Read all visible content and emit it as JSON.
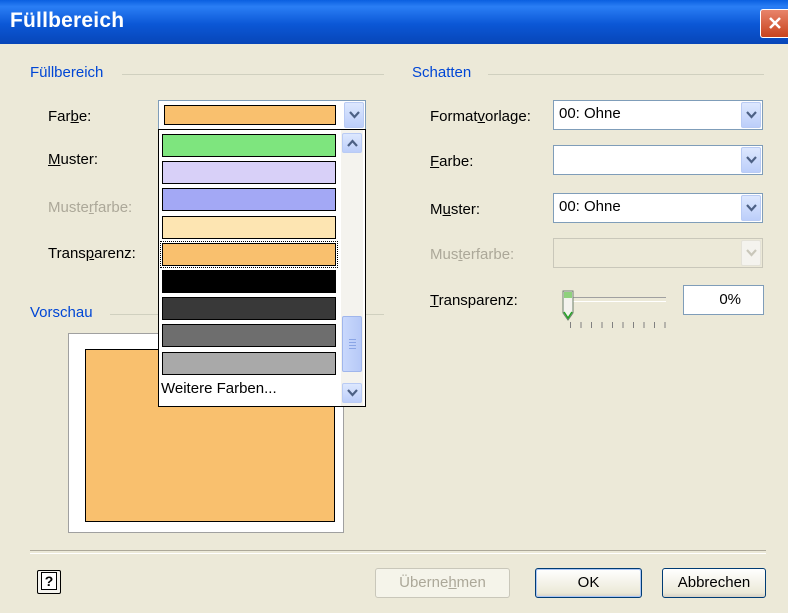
{
  "window": {
    "title": "Füllbereich",
    "close_icon": "close-icon"
  },
  "fill_group": {
    "title": "Füllbereich",
    "color_label": {
      "pre": "Far",
      "u": "b",
      "post": "e:"
    },
    "pattern_label": {
      "pre": "",
      "u": "M",
      "post": "uster:"
    },
    "pattern_color_label": {
      "pre": "Muste",
      "u": "r",
      "post": "farbe:"
    },
    "transparency_label": {
      "pre": "Trans",
      "u": "p",
      "post": "arenz:"
    },
    "selected_color": "#f9c06e"
  },
  "color_dropdown": {
    "items": [
      {
        "color": "#7ee57e"
      },
      {
        "color": "#d8d0f8"
      },
      {
        "color": "#a3a8f5"
      },
      {
        "color": "#fde5b2"
      },
      {
        "color": "#f9c06e",
        "selected": true
      },
      {
        "color": "#000000"
      },
      {
        "color": "#393939"
      },
      {
        "color": "#6e6e6e"
      },
      {
        "color": "#a9a9a9"
      }
    ],
    "more_colors": "Weitere Farben..."
  },
  "preview_group": {
    "title": "Vorschau",
    "shape_color": "#f9c06e"
  },
  "shadow_group": {
    "title": "Schatten",
    "style_label": {
      "pre": "Format",
      "u": "v",
      "post": "orlage:"
    },
    "style_value": "00: Ohne",
    "color_label": {
      "pre": "",
      "u": "F",
      "post": "arbe:"
    },
    "pattern_label": {
      "pre": "M",
      "u": "u",
      "post": "ster:"
    },
    "pattern_value": "00: Ohne",
    "pattern_color_label": {
      "pre": "Mus",
      "u": "t",
      "post": "erfarbe:"
    },
    "transparency_label": {
      "pre": "",
      "u": "T",
      "post": "ransparenz:"
    },
    "transparency_value": "0%",
    "transparency_level": 0
  },
  "buttons": {
    "apply": {
      "pre": "Überne",
      "u": "h",
      "post": "men"
    },
    "ok": "OK",
    "cancel": "Abbrechen",
    "help": "?"
  }
}
